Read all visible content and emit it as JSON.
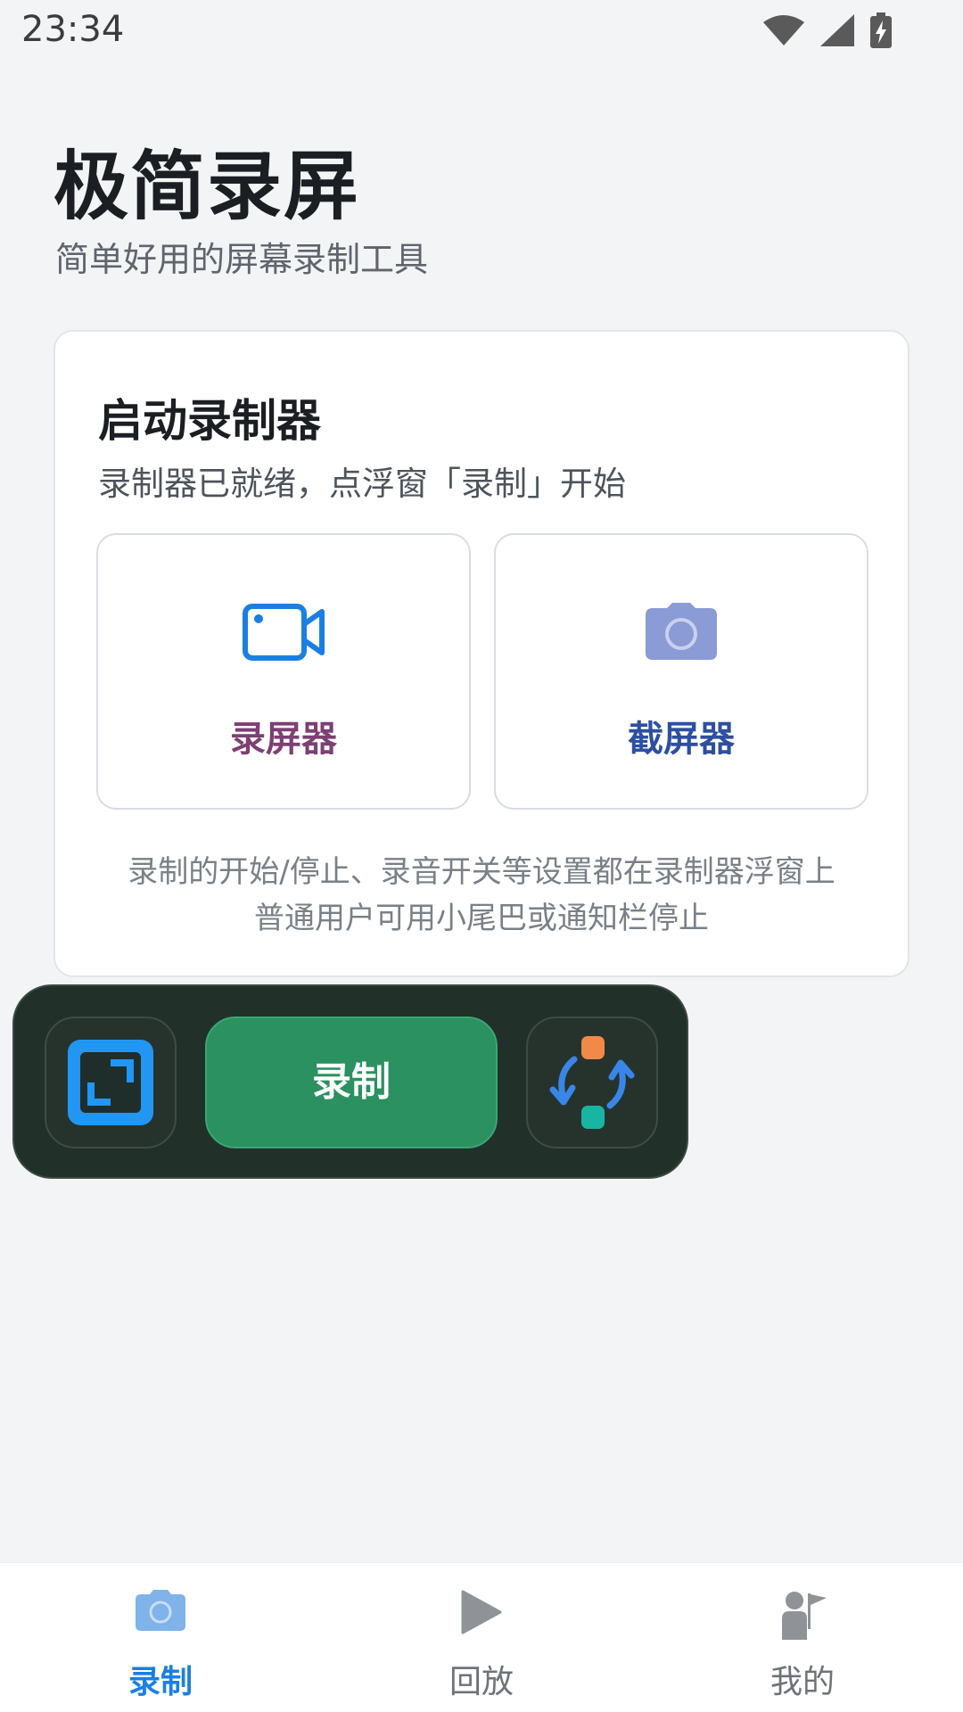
{
  "status_bar": {
    "time": "23:34",
    "icons": [
      "wifi-icon",
      "signal-icon",
      "battery-charging-icon"
    ]
  },
  "header": {
    "title": "极简录屏",
    "subtitle": "简单好用的屏幕录制工具"
  },
  "launcher_card": {
    "title": "启动录制器",
    "description": "录制器已就绪，点浮窗「录制」开始",
    "tools": [
      {
        "label": "录屏器",
        "icon": "video-camera-icon",
        "label_color": "#7d3f74",
        "icon_color": "#1a7fe3"
      },
      {
        "label": "截屏器",
        "icon": "photo-camera-icon",
        "label_color": "#2d4fa0",
        "icon_color": "#8a9bd6"
      }
    ],
    "note_line1": "录制的开始/停止、录音开关等设置都在录制器浮窗上",
    "note_line2": "普通用户可用小尾巴或通知栏停止"
  },
  "floating_bar": {
    "left_button_icon": "resize-icon",
    "record_label": "录制",
    "right_button_icon": "switch-icon"
  },
  "bottom_nav": {
    "items": [
      {
        "label": "录制",
        "icon": "camera-icon",
        "active": true
      },
      {
        "label": "回放",
        "icon": "play-icon",
        "active": false
      },
      {
        "label": "我的",
        "icon": "profile-icon",
        "active": false
      }
    ]
  },
  "colors": {
    "accent": "#1a7fe3",
    "record_green": "#2b9160",
    "float_bg": "#22302a"
  }
}
